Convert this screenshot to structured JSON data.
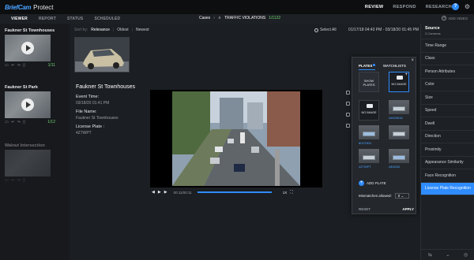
{
  "topbar": {
    "logo": "BriefCam",
    "product": "Protect",
    "nav": [
      "REVIEW",
      "RESPOND",
      "RESEARCH"
    ],
    "help_icon": "help-icon",
    "settings_icon": "gear-icon"
  },
  "subbar": {
    "tabs": [
      "VIEWER",
      "REPORT",
      "STATUS",
      "SCHEDULED"
    ],
    "crumbs": {
      "cases": "Cases",
      "case_name": "TRAFFIC VIOLATIONS",
      "count": "1/1122"
    },
    "add_video": "ADD VIDEO"
  },
  "cameras": [
    {
      "title": "Faukner St Townhouses",
      "count": "1/11"
    },
    {
      "title": "Faukner St Park",
      "count": "1/12"
    },
    {
      "title": "Walnut Intersection",
      "count": ""
    }
  ],
  "results": {
    "sort_label": "Sort by:",
    "sort_options": [
      "Relevance",
      "Oldest",
      "Newest"
    ],
    "select_all": "Select All",
    "date_range": "01/17/18 04:43 PM - 03/18/20 01:45 PM"
  },
  "detail": {
    "name": "Faukner St Townhouses",
    "event_time_label": "Event Time:",
    "event_time": "03/18/20 01:41 PM",
    "file_name_label": "File Name:",
    "file_name": "Faukner St Townhouses",
    "plate_label": "License Plate :",
    "plate": "4Z7WPT"
  },
  "player": {
    "time": "00:11/00:11",
    "speed": "1X"
  },
  "plates_popup": {
    "tabs": [
      "PLATES",
      "WATCHLISTS"
    ],
    "show_plates": "SHOW PLATES",
    "no_image": "NO IMAGE",
    "plate_captions": [
      "AHG5518",
      "8G07831",
      "4Z7WPT",
      "4Z7WPT",
      "AE8330"
    ],
    "add_plate": "ADD PLATE",
    "mismatches_label": "Mismatches allowed:",
    "mismatches_value": "0",
    "reset": "RESET",
    "apply": "APPLY"
  },
  "filters": {
    "source_title": "Source",
    "source_sub": "3 Cameras",
    "items": [
      "Time Range",
      "Class",
      "Person Attributes",
      "Color",
      "Size",
      "Speed",
      "Dwell",
      "Direction",
      "Proximity",
      "Appearance Similarity",
      "Face Recognition",
      "License Plate Recognition"
    ]
  },
  "colors": {
    "accent": "#2f8cff",
    "count_green": "#6fd16f"
  }
}
